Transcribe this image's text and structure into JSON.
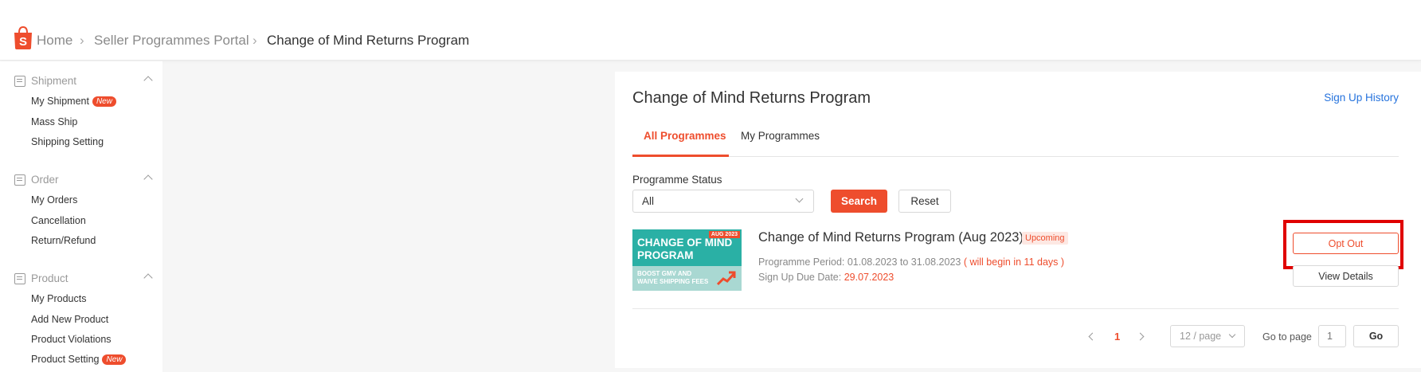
{
  "breadcrumb": {
    "home": "Home",
    "portal": "Seller Programmes Portal",
    "current": "Change of Mind Returns Program"
  },
  "sidebar": {
    "sections": [
      {
        "label": "Shipment",
        "items": [
          {
            "label": "My Shipment",
            "badge": "New"
          },
          {
            "label": "Mass Ship"
          },
          {
            "label": "Shipping Setting"
          }
        ]
      },
      {
        "label": "Order",
        "items": [
          {
            "label": "My Orders"
          },
          {
            "label": "Cancellation"
          },
          {
            "label": "Return/Refund"
          }
        ]
      },
      {
        "label": "Product",
        "items": [
          {
            "label": "My Products"
          },
          {
            "label": "Add New Product"
          },
          {
            "label": "Product Violations"
          },
          {
            "label": "Product Setting",
            "badge": "New"
          }
        ]
      }
    ]
  },
  "main": {
    "title": "Change of Mind Returns Program",
    "signup_history": "Sign Up History",
    "tabs": [
      {
        "label": "All Programmes",
        "active": true
      },
      {
        "label": "My Programmes",
        "active": false
      }
    ],
    "filter": {
      "label": "Programme Status",
      "value": "All",
      "search_label": "Search",
      "reset_label": "Reset"
    },
    "programme": {
      "banner": {
        "tag": "AUG 2023",
        "line1": "CHANGE OF MIND PROGRAM",
        "line2": "BOOST GMV AND WAIVE SHIPPING FEES"
      },
      "title": "Change of Mind Returns Program (Aug 2023)",
      "status": "Upcoming",
      "period_label": "Programme Period: ",
      "period_value": "01.08.2023 to 31.08.2023",
      "period_note": " ( will begin in 11 days )",
      "due_label": "Sign Up Due Date: ",
      "due_value": "29.07.2023",
      "opt_out_label": "Opt Out",
      "view_details_label": "View Details"
    },
    "pagination": {
      "current_page": "1",
      "page_size": "12 / page",
      "goto_label": "Go to page",
      "goto_placeholder": "1",
      "go_label": "Go"
    }
  },
  "colors": {
    "brand": "#ee4d2d",
    "link": "#2673dd",
    "highlight_frame": "#e00000"
  }
}
